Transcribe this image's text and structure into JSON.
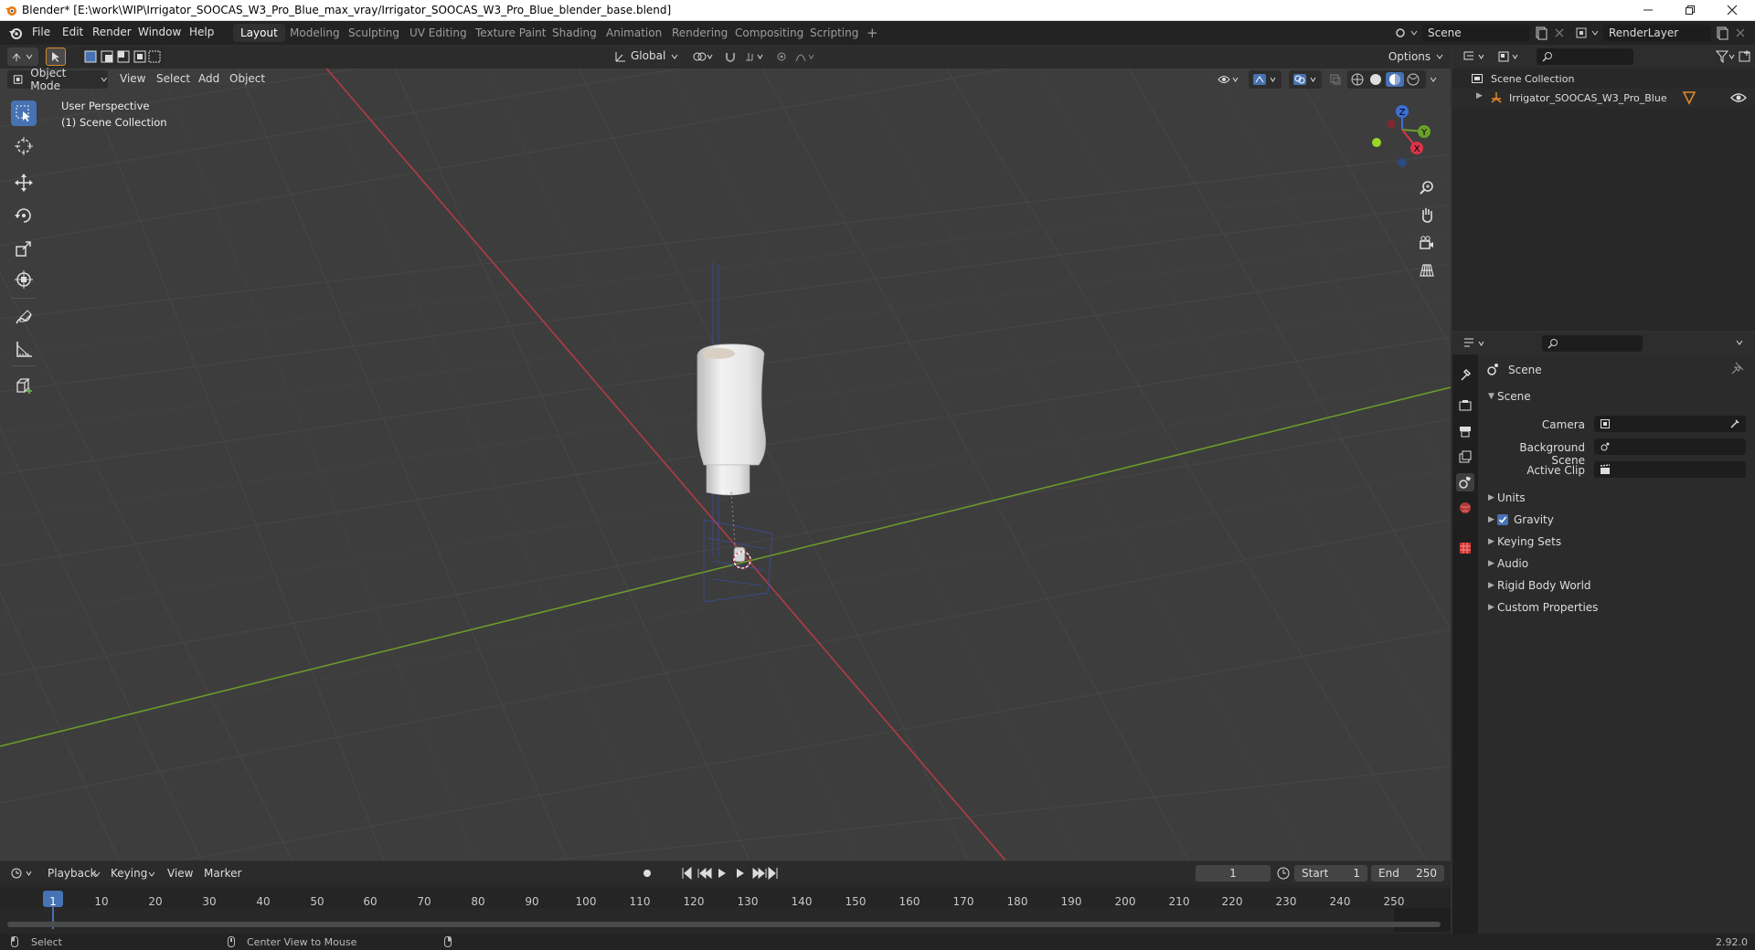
{
  "window": {
    "title": "Blender* [E:\\work\\WIP\\Irrigator_SOOCAS_W3_Pro_Blue_max_vray/Irrigator_SOOCAS_W3_Pro_Blue_blender_base.blend]",
    "controls": [
      "minimize-icon",
      "maximize-icon",
      "close-icon"
    ]
  },
  "menu": {
    "items": [
      "File",
      "Edit",
      "Render",
      "Window",
      "Help"
    ]
  },
  "workspaces": {
    "tabs": [
      "Layout",
      "Modeling",
      "Sculpting",
      "UV Editing",
      "Texture Paint",
      "Shading",
      "Animation",
      "Rendering",
      "Compositing",
      "Scripting"
    ],
    "active": "Layout",
    "add": "+"
  },
  "scene_selector": {
    "value": "Scene"
  },
  "viewlayer_selector": {
    "value": "RenderLayer"
  },
  "viewport": {
    "transform_orientation": "Global",
    "options_label": "Options",
    "mode": "Object Mode",
    "menus": [
      "View",
      "Select",
      "Add",
      "Object"
    ],
    "overlay_text": {
      "perspective": "User Perspective",
      "collection": "(1) Scene Collection"
    },
    "gizmo_axes": [
      "Z",
      "Y",
      "X"
    ],
    "colors": {
      "background": "#3d3d3d",
      "grid": "#4a4a4a",
      "x_axis": "#c43b45",
      "y_axis": "#6a9a2c",
      "active_tool": "#4772b3"
    }
  },
  "toolbar": {
    "tools": [
      "select-box-icon",
      "cursor-icon",
      "move-icon",
      "rotate-icon",
      "scale-icon",
      "transform-icon",
      "annotate-icon",
      "measure-icon",
      "add-cube-icon"
    ],
    "active": "select-box-icon"
  },
  "outliner": {
    "root": "Scene Collection",
    "items": [
      {
        "name": "Irrigator_SOOCAS_W3_Pro_Blue"
      }
    ]
  },
  "properties": {
    "context": "Scene",
    "panel_title": "Scene",
    "fields": [
      {
        "label": "Camera",
        "value": ""
      },
      {
        "label": "Background Scene",
        "value": ""
      },
      {
        "label": "Active Clip",
        "value": ""
      }
    ],
    "sections": [
      {
        "label": "Units",
        "checkbox": false
      },
      {
        "label": "Gravity",
        "checkbox": true,
        "checked": true
      },
      {
        "label": "Keying Sets",
        "checkbox": false
      },
      {
        "label": "Audio",
        "checkbox": false
      },
      {
        "label": "Rigid Body World",
        "checkbox": false
      },
      {
        "label": "Custom Properties",
        "checkbox": false
      }
    ]
  },
  "timeline": {
    "menus": [
      "Playback",
      "Keying",
      "View",
      "Marker"
    ],
    "current_frame": "1",
    "start_label": "Start",
    "start": "1",
    "end_label": "End",
    "end": "250",
    "ruler": [
      "1",
      "10",
      "20",
      "30",
      "40",
      "50",
      "60",
      "70",
      "80",
      "90",
      "100",
      "110",
      "120",
      "130",
      "140",
      "150",
      "160",
      "170",
      "180",
      "190",
      "200",
      "210",
      "220",
      "230",
      "240",
      "250"
    ]
  },
  "statusbar": {
    "left_hint": "Select",
    "middle_hint": "Center View to Mouse",
    "version": "2.92.0"
  }
}
